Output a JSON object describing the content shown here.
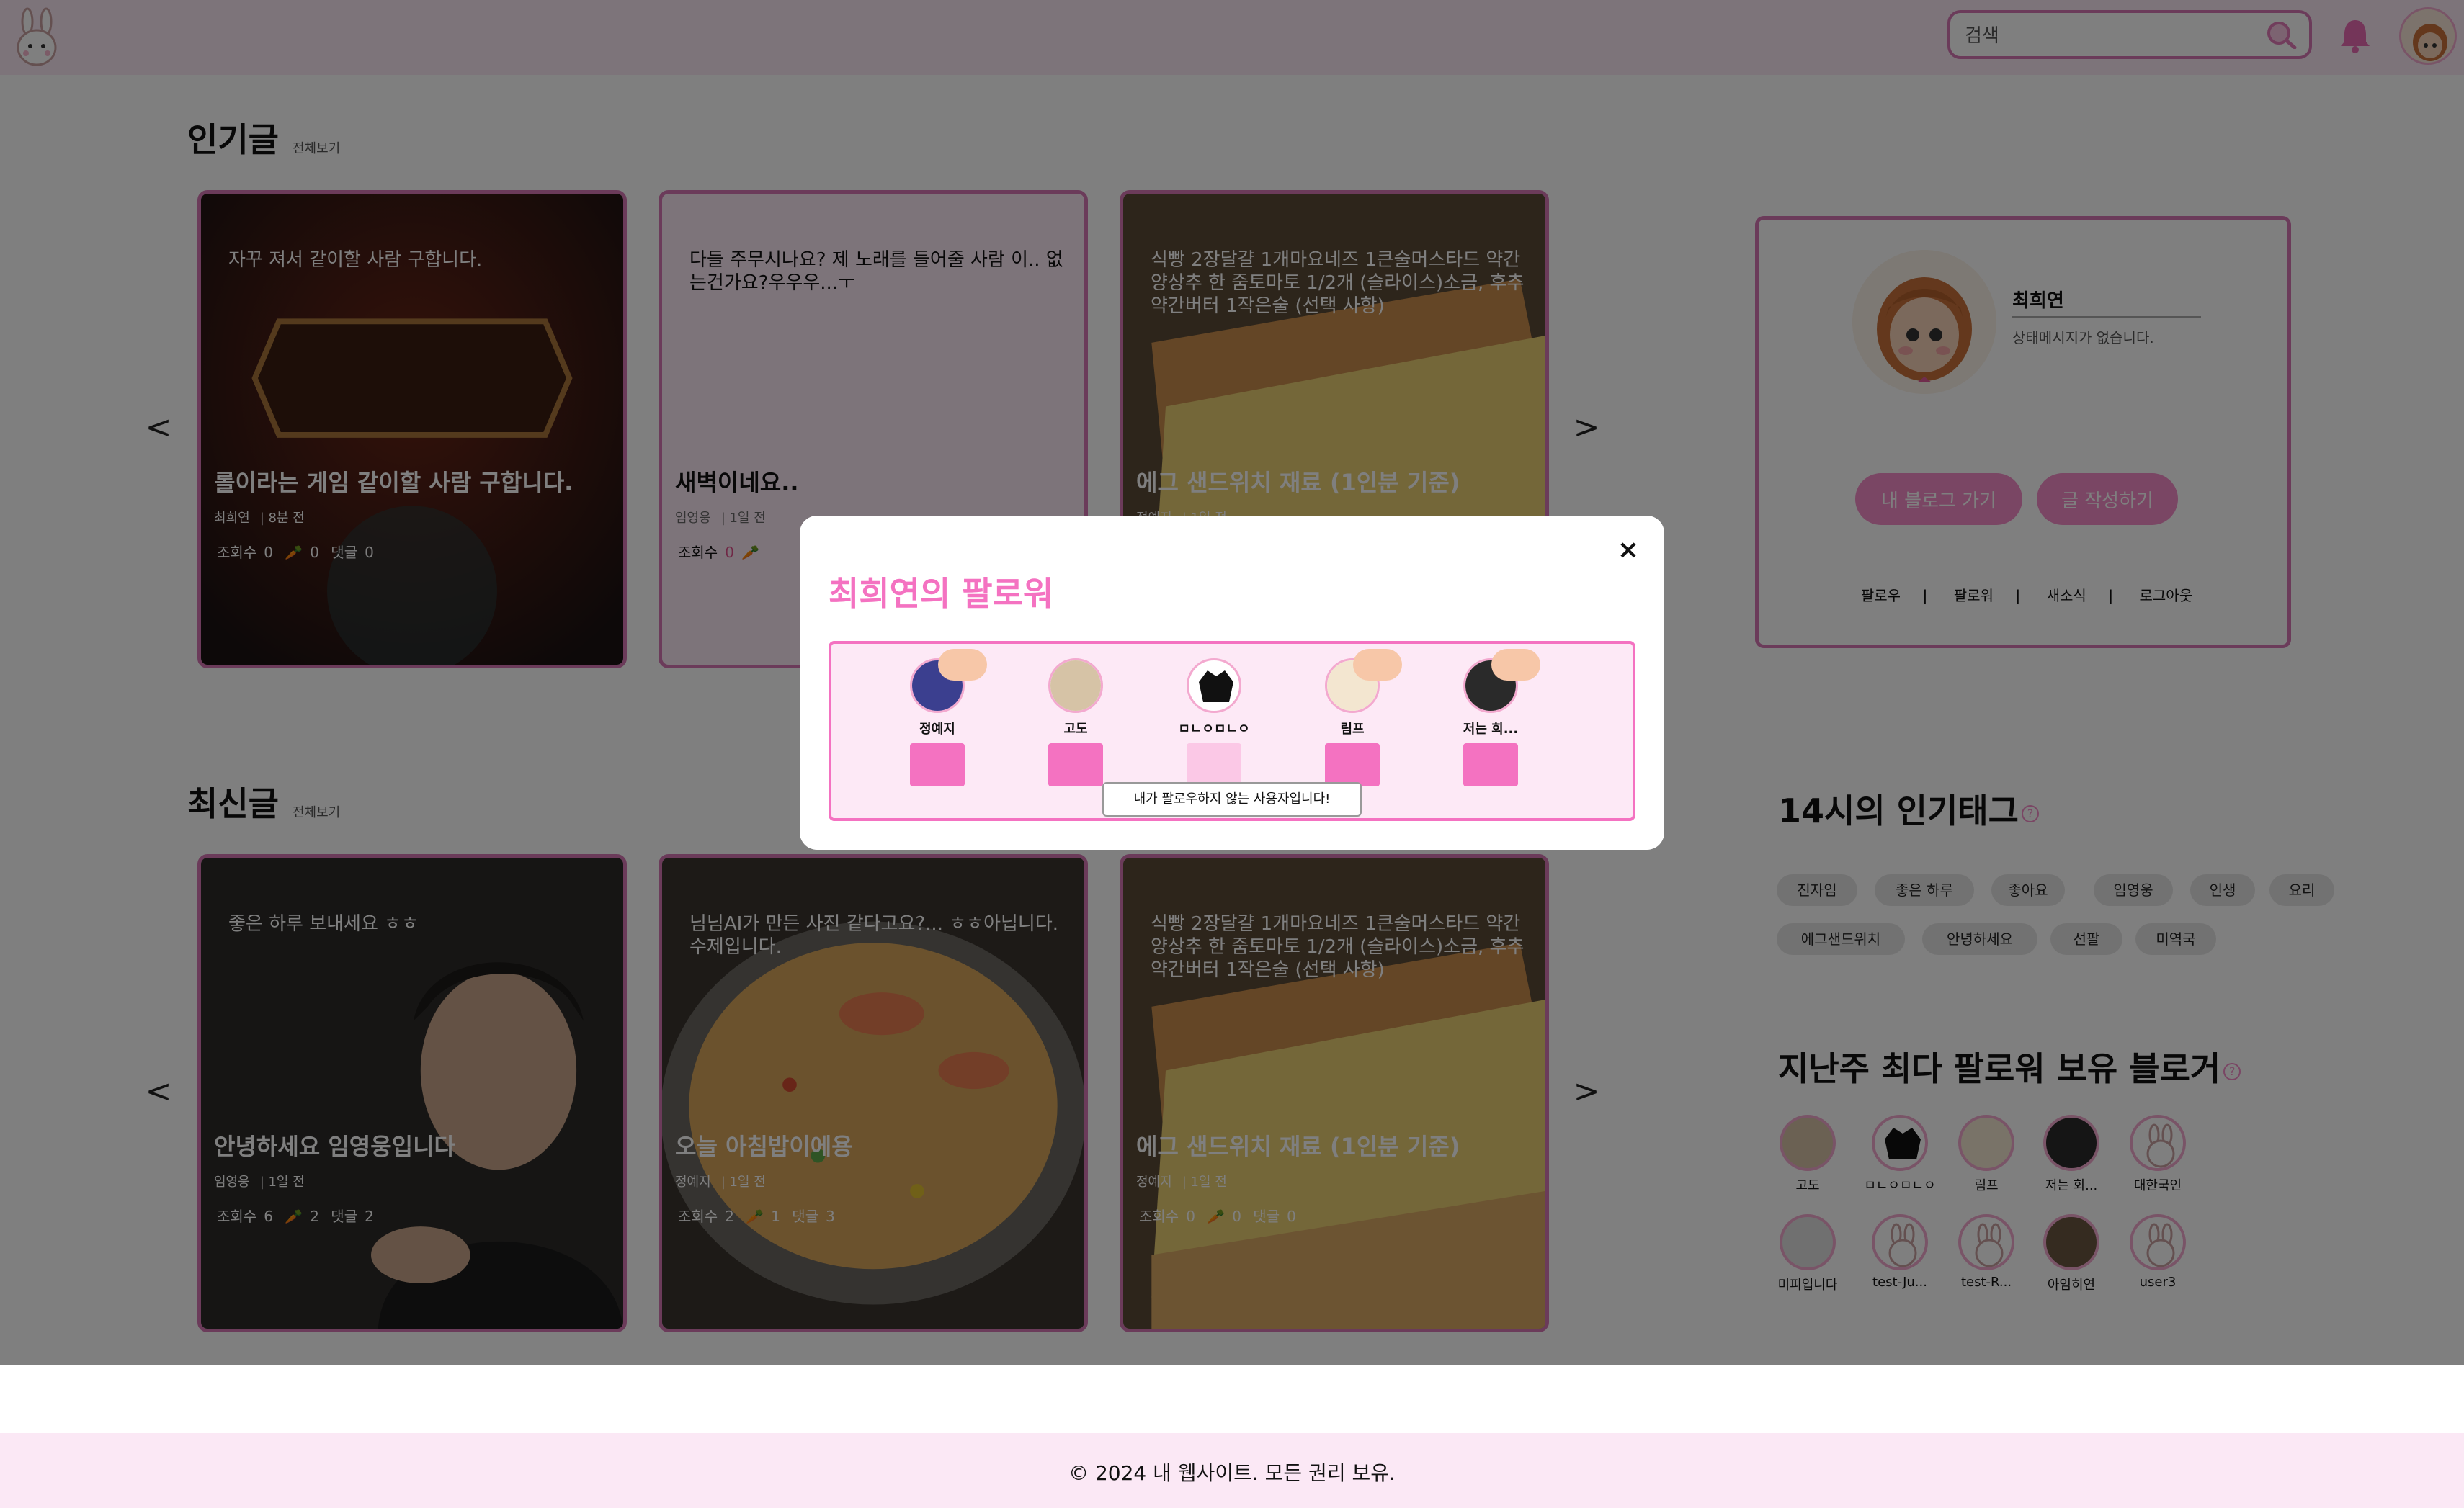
{
  "header": {
    "search_placeholder": "검색",
    "logo_icon": "bunny-logo-icon",
    "search_icon": "search-icon",
    "bell_icon": "bell-icon"
  },
  "popular": {
    "title": "인기글",
    "more": "전체보기",
    "prev": "<",
    "next": ">",
    "cards": [
      {
        "snippet": "자꾸 져서 같이할 사람 구합니다.",
        "title": "롤이라는 게임 같이할 사람 구합니다.",
        "author": "최희연",
        "time": "| 8분 전",
        "views_label": "조회수",
        "views": "0",
        "likes": "0",
        "comments_label": "댓글",
        "comments": "0"
      },
      {
        "snippet": "다들 주무시나요? 제 노래를 들어줄 사람 이.. 없는건가요?우우우...ㅜ",
        "title": "새벽이네요..",
        "author": "임영웅",
        "time": "| 1일 전",
        "views_label": "조회수",
        "views": "0"
      },
      {
        "snippet": "식빵 2장달걀 1개마요네즈 1큰술머스타드 약간양상추 한 줌토마토 1/2개 (슬라이스)소금, 후추 약간버터 1작은술 (선택 사항)",
        "title": "에그 샌드위치 재료 (1인분 기준)",
        "author": "정예지",
        "time": "| 1일 전"
      }
    ]
  },
  "latest": {
    "title": "최신글",
    "more": "전체보기",
    "prev": "<",
    "next": ">",
    "cards": [
      {
        "snippet": "좋은 하루 보내세요 ㅎㅎ",
        "title": "안녕하세요 임영웅입니다",
        "author": "임영웅",
        "time": "| 1일 전",
        "views_label": "조회수",
        "views": "6",
        "likes": "2",
        "comments_label": "댓글",
        "comments": "2"
      },
      {
        "snippet": "님님AI가 만든 사진 같다고요?... ㅎㅎ아닙니다. 수제입니다.",
        "title": "오늘 아침밥이에용",
        "author": "정예지",
        "time": "| 1일 전",
        "views_label": "조회수",
        "views": "2",
        "likes": "1",
        "comments_label": "댓글",
        "comments": "3"
      },
      {
        "snippet": "식빵 2장달걀 1개마요네즈 1큰술머스타드 약간양상추 한 줌토마토 1/2개 (슬라이스)소금, 후추 약간버터 1작은술 (선택 사항)",
        "title": "에그 샌드위치 재료 (1인분 기준)",
        "author": "정예지",
        "time": "| 1일 전",
        "views_label": "조회수",
        "views": "0",
        "likes": "0",
        "comments_label": "댓글",
        "comments": "0"
      }
    ]
  },
  "profile": {
    "name": "최희연",
    "status": "상태메시지가 없습니다.",
    "blog_button": "내 블로그 가기",
    "write_button": "글 작성하기",
    "links": [
      "팔로우",
      "팔로워",
      "새소식",
      "로그아웃"
    ],
    "sep": "|"
  },
  "tags": {
    "title": "14시의 인기태그",
    "help": "?",
    "items": [
      "진자임",
      "좋은 하루",
      "좋아요",
      "임영웅",
      "인생",
      "요리",
      "에그샌드위치",
      "안녕하세요",
      "선팔",
      "미역국"
    ]
  },
  "bloggers": {
    "title": "지난주 최다 팔로워 보유 블로거",
    "help": "?",
    "items": [
      "고도",
      "ㅁㄴㅇㅁㄴㅇ",
      "림프",
      "저는 회...",
      "대한국인",
      "미피입니다",
      "test-Ju...",
      "test-R...",
      "아임히연",
      "user3"
    ]
  },
  "modal": {
    "title": "최희연의 팔로워",
    "close": "×",
    "followers": [
      "정예지",
      "고도",
      "ㅁㄴㅇㅁㄴㅇ",
      "림프",
      "저는 회..."
    ],
    "tooltip": "내가 팔로우하지 않는 사용자입니다!"
  },
  "footer": {
    "text": "© 2024 내 웹사이트. 모든 권리 보유."
  },
  "colors": {
    "accent": "#f472c1",
    "border": "#d776b4",
    "header_bg": "#fbe8f5",
    "tag_bg": "#e5e5e5"
  }
}
